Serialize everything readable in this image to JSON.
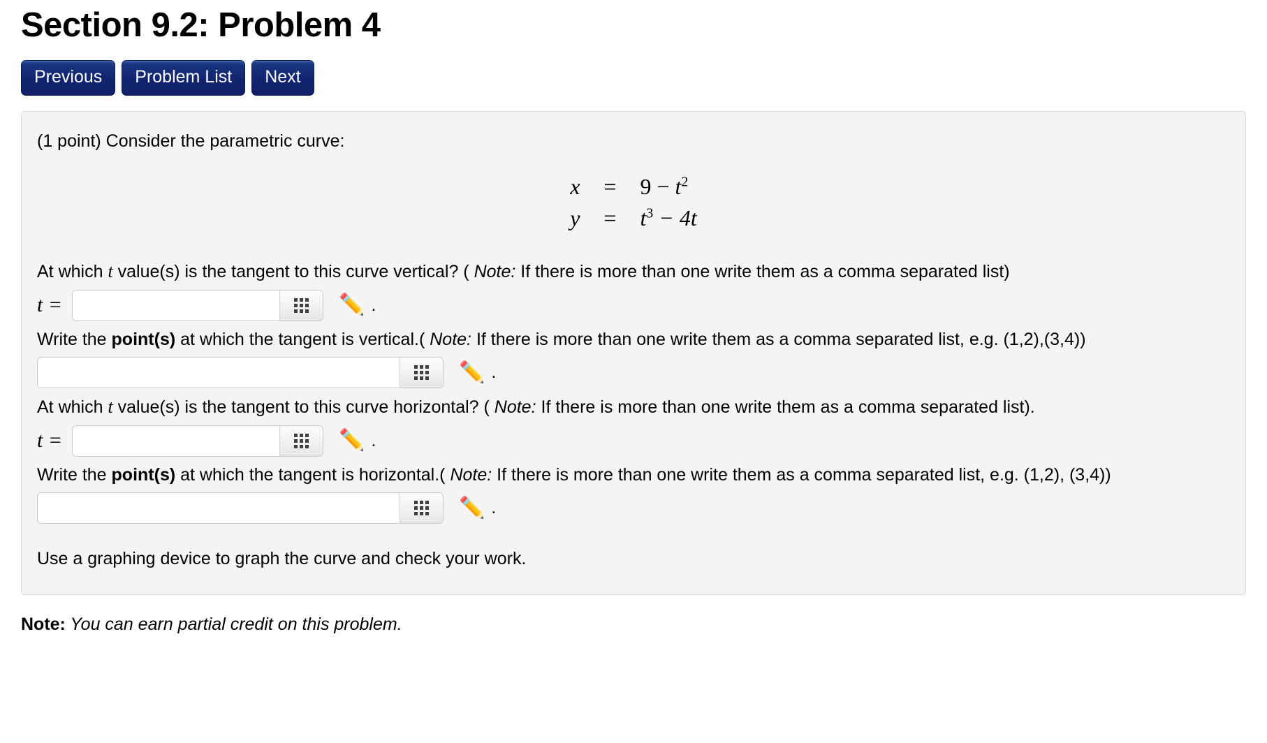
{
  "header": {
    "title": "Section 9.2: Problem 4"
  },
  "nav": {
    "buttons": [
      {
        "label": "Previous"
      },
      {
        "label": "Problem List"
      },
      {
        "label": "Next"
      }
    ]
  },
  "problem": {
    "intro": "(1 point) Consider the parametric curve:",
    "equations": [
      {
        "lhs": "x",
        "eq": "=",
        "rhs_pre": "9 − ",
        "rhs_var": "t",
        "rhs_exp": "2",
        "rhs_post": ""
      },
      {
        "lhs": "y",
        "eq": "=",
        "rhs_pre": "",
        "rhs_var": "t",
        "rhs_exp": "3",
        "rhs_post": " − 4t"
      }
    ],
    "questions": [
      {
        "id": "vertical-t",
        "text_before_var": "At which ",
        "var": "t",
        "text_after_var": " value(s) is the tangent to this curve vertical? ( ",
        "note_label": "Note:",
        "note_text": " If there is more than one write them as a comma separated list)",
        "label": "t =",
        "input_value": "",
        "input_placeholder": "",
        "grid_button_title": "grid",
        "pencil_icon": "✏️",
        "trailing": "."
      },
      {
        "id": "vertical-points",
        "text_plain_1": "Write the ",
        "text_bold": "point(s)",
        "text_plain_2": " at which the tangent is vertical.( ",
        "note_label": "Note:",
        "note_text": " If there is more than one write them as a comma separated list, e.g. (1,2),(3,4))",
        "label": "",
        "input_value": "",
        "input_placeholder": "",
        "grid_button_title": "grid",
        "pencil_icon": "✏️",
        "trailing": "."
      },
      {
        "id": "horizontal-t",
        "text_before_var": "At which ",
        "var": "t",
        "text_after_var": " value(s) is the tangent to this curve horizontal? ( ",
        "note_label": "Note:",
        "note_text": " If there is more than one write them as a comma separated list).",
        "label": "t =",
        "input_value": "",
        "input_placeholder": "",
        "grid_button_title": "grid",
        "pencil_icon": "✏️",
        "trailing": "."
      },
      {
        "id": "horizontal-points",
        "text_plain_1": "Write the ",
        "text_bold": "point(s)",
        "text_plain_2": " at which the tangent is horizontal.( ",
        "note_label": "Note:",
        "note_text": " If there is more than one write them as a comma separated list, e.g. (1,2), (3,4))",
        "label": "",
        "input_value": "",
        "input_placeholder": "",
        "grid_button_title": "grid",
        "pencil_icon": "✏️",
        "trailing": "."
      }
    ],
    "closing": "Use a graphing device to graph the curve and check your work."
  },
  "footer": {
    "note_label": "Note:",
    "note_text": " You can earn partial credit on this problem."
  },
  "colors": {
    "button_blue": "#12246f",
    "panel_bg": "#f4f4f4",
    "panel_border": "#dcdcdc"
  }
}
